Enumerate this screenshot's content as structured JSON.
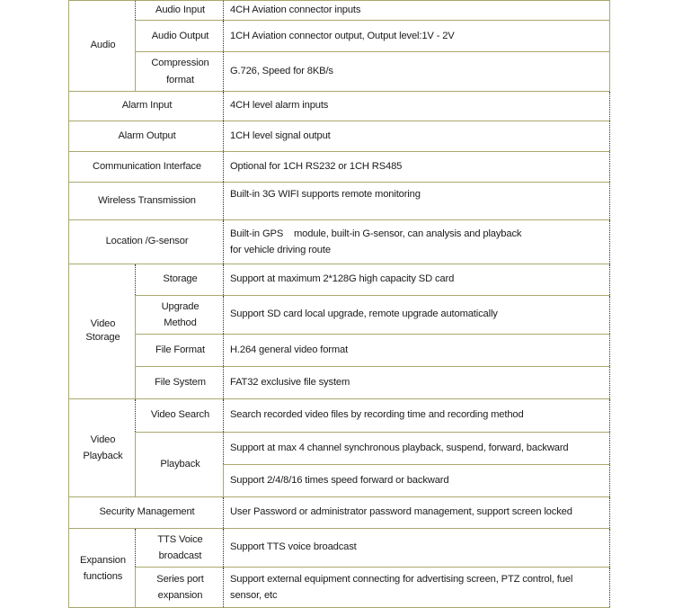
{
  "document": {
    "type": "specification-table",
    "title": "Product Specification Table",
    "colors": {
      "border_olive": "#a9a86f",
      "border_dotted": "#2f2f2f",
      "text": "#1b1b1b",
      "background": "#ffffff"
    }
  },
  "table": {
    "rows": [
      {
        "category": "Audio",
        "category_rowspan": 3,
        "subitem": "Audio Input",
        "description": "4CH Aviation connector inputs",
        "solid_right": true
      },
      {
        "subitem": "Audio Output",
        "description": "1CH Aviation connector output, Output level:1V - 2V",
        "solid_right": true
      },
      {
        "subitem": "Compression format",
        "subitem_lines": [
          "Compression",
          "format"
        ],
        "description": "G.726, Speed for 8KB/s",
        "solid_right": true
      },
      {
        "category": "Alarm Input",
        "category_colspan": 2,
        "description": "4CH level alarm inputs"
      },
      {
        "category": "Alarm Output",
        "category_colspan": 2,
        "description": "1CH level signal output"
      },
      {
        "category": "Communication Interface",
        "category_colspan": 2,
        "description": "Optional for 1CH RS232 or 1CH RS485"
      },
      {
        "category": "Wireless Transmission",
        "category_colspan": 2,
        "description": "Built-in 3G WIFI supports remote monitoring"
      },
      {
        "category": "Location /G-sensor",
        "category_colspan": 2,
        "description_lines": [
          "Built-in GPS    module, built-in G-sensor, can analysis and playback",
          "for vehicle driving route"
        ]
      },
      {
        "category": "Video Storage",
        "category_rowspan": 4,
        "subitem": "Storage",
        "description": "Support at maximum 2*128G high capacity SD card"
      },
      {
        "subitem": "Upgrade Method",
        "subitem_lines": [
          "Upgrade",
          "Method"
        ],
        "description": "Support SD card local upgrade, remote upgrade automatically"
      },
      {
        "subitem": "File Format",
        "description": "H.264 general video format"
      },
      {
        "subitem": "File System",
        "description": "FAT32 exclusive file system"
      },
      {
        "category": "Video Playback",
        "category_lines": [
          "Video",
          "Playback"
        ],
        "category_rowspan": 3,
        "subitem": "Video Search",
        "description": "Search recorded video files by recording time and recording method"
      },
      {
        "subitem": "Playback",
        "subitem_rowspan": 2,
        "description": "Support at max 4 channel synchronous playback, suspend, forward, backward"
      },
      {
        "description": "Support 2/4/8/16 times speed forward or backward"
      },
      {
        "category": "Security Management",
        "category_colspan": 2,
        "description": "User Password or administrator password management, support screen locked"
      },
      {
        "category": "Expansion functions",
        "category_lines": [
          "Expansion",
          "functions"
        ],
        "category_rowspan": 2,
        "subitem": "TTS Voice broadcast",
        "subitem_lines": [
          "TTS Voice",
          "broadcast"
        ],
        "description": "Support TTS voice broadcast"
      },
      {
        "subitem": "Series port expansion",
        "subitem_lines": [
          "Series port",
          "expansion"
        ],
        "description_lines": [
          "Support external equipment connecting for advertising screen, PTZ control, fuel",
          "sensor, etc"
        ]
      }
    ]
  }
}
